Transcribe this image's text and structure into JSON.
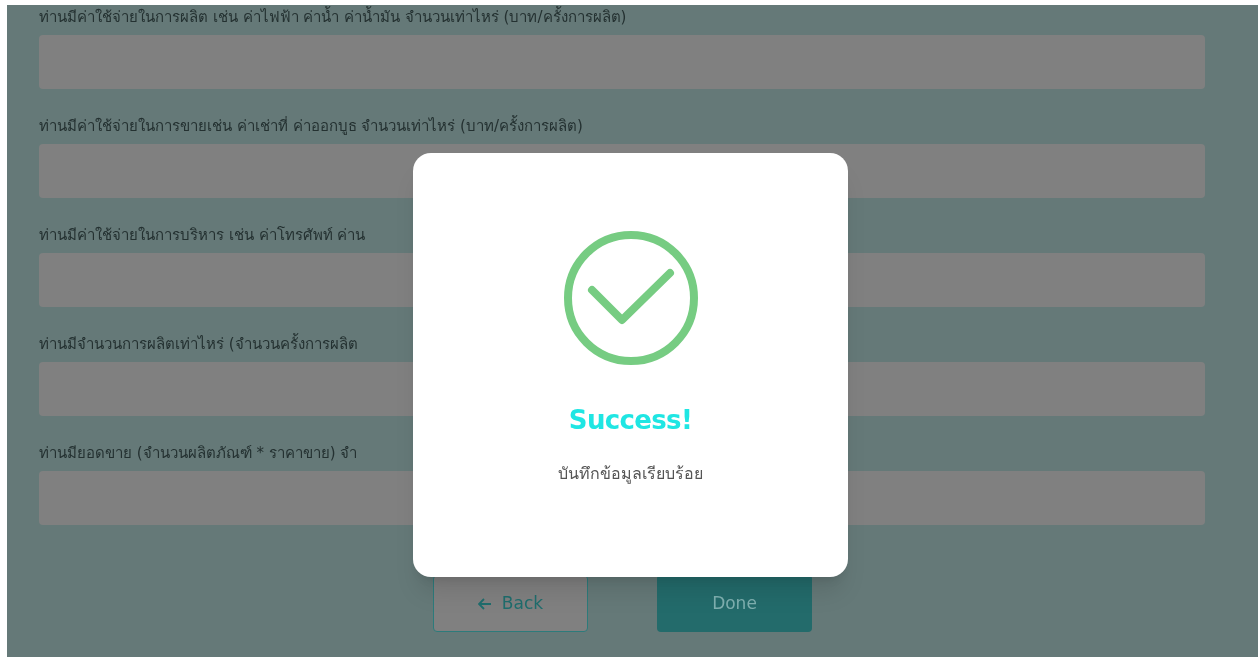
{
  "form": {
    "fields": [
      {
        "label": "ท่านมีค่าใช้จ่ายในการผลิต เช่น ค่าไฟฟ้า ค่าน้ำ ค่าน้ำมัน จำนวนเท่าไหร่ (บาท/ครั้งการผลิต)"
      },
      {
        "label": "ท่านมีค่าใช้จ่ายในการขายเช่น ค่าเช่าที่ ค่าออกบูธ จำนวนเท่าไหร่ (บาท/ครั้งการผลิต)"
      },
      {
        "label": "ท่านมีค่าใช้จ่ายในการบริหาร เช่น ค่าโทรศัพท์ ค่าน"
      },
      {
        "label": "ท่านมีจำนวนการผลิตเท่าไหร่ (จำนวนครั้งการผลิต"
      },
      {
        "label": "ท่านมียอดขาย (จำนวนผลิตภัณฑ์ * ราคาขาย) จำ"
      }
    ],
    "buttons": [
      {
        "kind": "back",
        "label": "Back"
      },
      {
        "kind": "done",
        "label": "Done"
      }
    ]
  },
  "dialog": {
    "title": "Success!",
    "message": "บันทึกข้อมูลเรียบร้อย"
  }
}
